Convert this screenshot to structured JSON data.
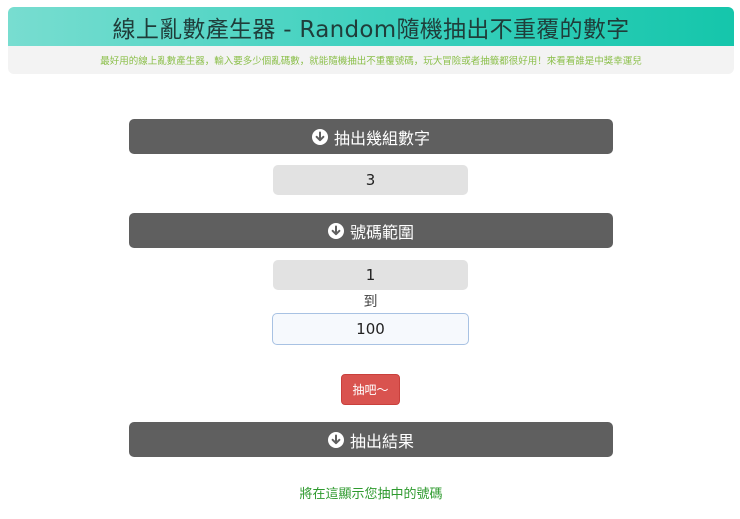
{
  "header": {
    "title": "線上亂數產生器 - Random隨機抽出不重覆的數字",
    "subtitle": "最好用的線上亂數產生器，輸入要多少個亂碼數，就能隨機抽出不重覆號碼，玩大冒險或者抽籤都很好用！來看看誰是中獎幸運兒"
  },
  "count_section": {
    "header_label": "抽出幾組數字",
    "icon": "arrow-down-circle-icon",
    "value": "3"
  },
  "range_section": {
    "header_label": "號碼範圍",
    "icon": "arrow-down-circle-icon",
    "min_value": "1",
    "to_label": "到",
    "max_value": "100"
  },
  "draw_button": {
    "label": "抽吧～",
    "color": "#d9534f"
  },
  "result_section": {
    "header_label": "抽出結果",
    "icon": "arrow-down-circle-icon",
    "placeholder_text": "將在這顯示您抽中的號碼",
    "text_color": "#2e9a2e"
  },
  "colors": {
    "banner_gradient_start": "#78ddd0",
    "banner_gradient_end": "#15c6ab",
    "section_header_bg": "#5f5f5f",
    "subtitle_color": "#8bbf4a"
  }
}
